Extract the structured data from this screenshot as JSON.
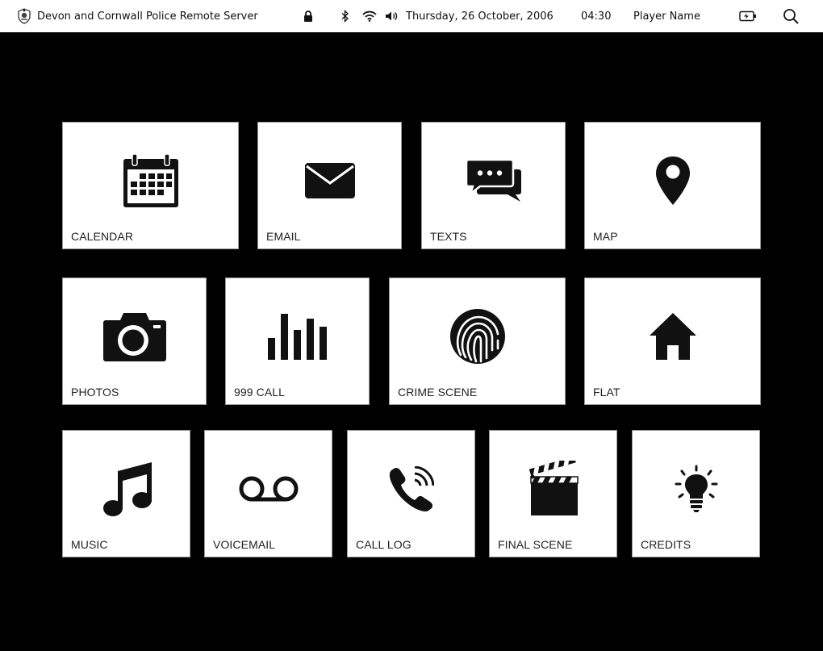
{
  "menubar": {
    "title": "Devon and Cornwall Police Remote Server",
    "date": "Thursday, 26 October, 2006",
    "time": "04:30",
    "user": "Player Name",
    "icons": [
      "police-crest-icon",
      "lock-icon",
      "bluetooth-icon",
      "wifi-icon",
      "volume-icon",
      "battery-icon",
      "search-icon"
    ]
  },
  "tiles": [
    {
      "label": "CALENDAR",
      "icon": "calendar-icon"
    },
    {
      "label": "EMAIL",
      "icon": "envelope-icon"
    },
    {
      "label": "TEXTS",
      "icon": "chat-bubbles-icon"
    },
    {
      "label": "MAP",
      "icon": "map-pin-icon"
    },
    {
      "label": "PHOTOS",
      "icon": "camera-icon"
    },
    {
      "label": "999 CALL",
      "icon": "audio-bars-icon"
    },
    {
      "label": "CRIME SCENE",
      "icon": "fingerprint-icon"
    },
    {
      "label": "FLAT",
      "icon": "house-icon"
    },
    {
      "label": "MUSIC",
      "icon": "music-note-icon"
    },
    {
      "label": "VOICEMAIL",
      "icon": "voicemail-icon"
    },
    {
      "label": "CALL LOG",
      "icon": "phone-ringing-icon"
    },
    {
      "label": "FINAL SCENE",
      "icon": "clapperboard-icon"
    },
    {
      "label": "CREDITS",
      "icon": "lightbulb-icon"
    }
  ],
  "colors": {
    "background": "#000000",
    "tile": "#ffffff",
    "menubar": "#ffffff",
    "icon": "#111111"
  }
}
